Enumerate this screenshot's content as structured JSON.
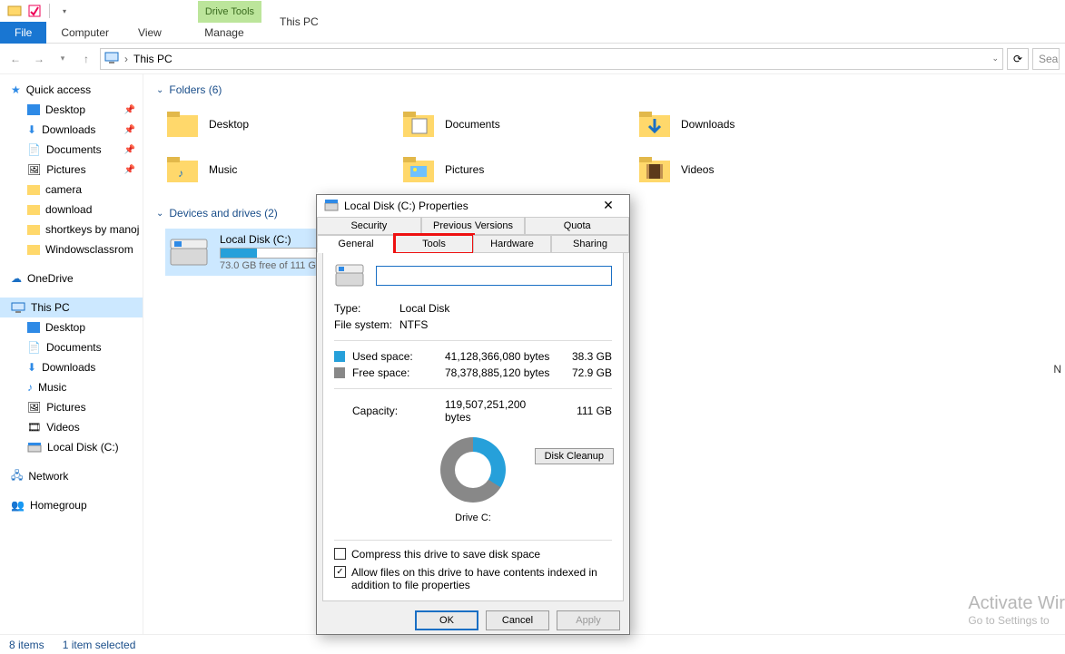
{
  "qat": {
    "drop_tooltip": "▾"
  },
  "ribbon": {
    "file": "File",
    "tabs": [
      "Computer",
      "View"
    ],
    "context_group": "Drive Tools",
    "context_tab": "Manage",
    "right_label": "This PC"
  },
  "nav": {
    "location": "This PC",
    "search_placeholder": "Sea"
  },
  "sidebar": {
    "quick_access": "Quick access",
    "qa_items": [
      {
        "label": "Desktop",
        "pin": true
      },
      {
        "label": "Downloads",
        "pin": true
      },
      {
        "label": "Documents",
        "pin": true
      },
      {
        "label": "Pictures",
        "pin": true
      },
      {
        "label": "camera",
        "pin": false
      },
      {
        "label": "download",
        "pin": false
      },
      {
        "label": "shortkeys by manoj",
        "pin": false
      },
      {
        "label": "Windowsclassrom",
        "pin": false
      }
    ],
    "onedrive": "OneDrive",
    "thispc": "This PC",
    "pc_items": [
      "Desktop",
      "Documents",
      "Downloads",
      "Music",
      "Pictures",
      "Videos",
      "Local Disk (C:)"
    ],
    "network": "Network",
    "homegroup": "Homegroup"
  },
  "content": {
    "folders_header": "Folders (6)",
    "folders": [
      "Desktop",
      "Documents",
      "Downloads",
      "Music",
      "Pictures",
      "Videos"
    ],
    "drives_header": "Devices and drives (2)",
    "drive": {
      "name": "Local Disk (C:)",
      "free_text": "73.0 GB free of 111 GB",
      "fill_pct": 34
    }
  },
  "status": {
    "items": "8 items",
    "selected": "1 item selected"
  },
  "dialog": {
    "title": "Local Disk (C:) Properties",
    "tabs_row1": [
      "Security",
      "Previous Versions",
      "Quota"
    ],
    "tabs_row2": [
      "General",
      "Tools",
      "Hardware",
      "Sharing"
    ],
    "active_tab": "General",
    "highlight_tab": "Tools",
    "type_label": "Type:",
    "type_value": "Local Disk",
    "fs_label": "File system:",
    "fs_value": "NTFS",
    "used_label": "Used space:",
    "used_bytes": "41,128,366,080 bytes",
    "used_gb": "38.3 GB",
    "free_label": "Free space:",
    "free_bytes": "78,378,885,120 bytes",
    "free_gb": "72.9 GB",
    "cap_label": "Capacity:",
    "cap_bytes": "119,507,251,200 bytes",
    "cap_gb": "111 GB",
    "drive_label": "Drive C:",
    "cleanup": "Disk Cleanup",
    "compress": "Compress this drive to save disk space",
    "index": "Allow files on this drive to have contents indexed in addition to file properties",
    "ok": "OK",
    "cancel": "Cancel",
    "apply": "Apply"
  },
  "watermark": {
    "big": "Activate Wir",
    "small": "Go to Settings to"
  },
  "side_letter": "N"
}
